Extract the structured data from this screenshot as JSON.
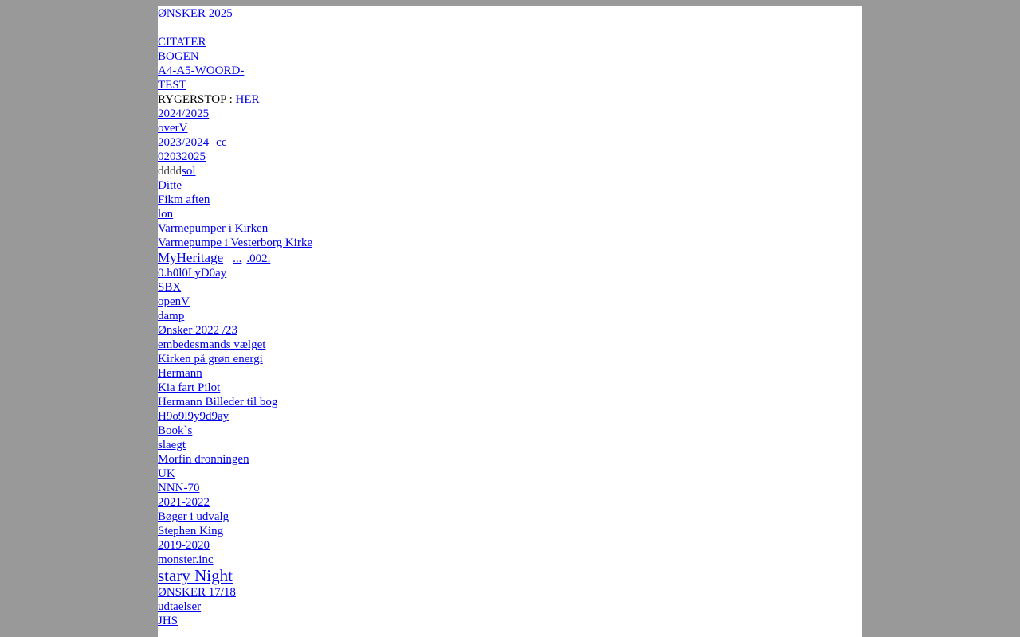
{
  "page": {
    "background": "#999999",
    "content_background": "#ffffff",
    "link_color": "#0000ee"
  },
  "links": {
    "onsker_2025": "ØNSKER 2025",
    "citater": "CITATER",
    "bogen": "BOGEN",
    "a4_a5_line1": "A4-A5-WOORD-",
    "a4_a5_line2": "TEST",
    "rygerstop_label": "RYGERSTOP :",
    "rygerstop_her": "HER",
    "y2024_2025": "2024/2025",
    "overv": "overV",
    "y2023_2024": "2023/2024",
    "cc": "cc",
    "d02032025": "02032025",
    "img_dd_1_alt": "dd",
    "img_dd_2_alt": "dd",
    "sol": "sol",
    "ditte": "Ditte",
    "fikm_aften": "Fikm aften",
    "lon": "lon",
    "varmepumper_kirken": "Varmepumper i Kirken",
    "varmepumpe_vesterborg": "Varmepumpe i Vesterborg Kirke",
    "myheritage": "MyHeritage",
    "dots": "...",
    "code_002": ".002.",
    "h0l0": "0.h0l0LyD0ay",
    "sbx": "SBX",
    "openv": "openV",
    "damp": "damp",
    "onsker_2022_23": "Ønsker 2022 /23",
    "embedesmands": "embedesmands vælget",
    "kirken_gron": "Kirken på grøn energi",
    "hermann": "Hermann",
    "kia_fart": "Kia fart Pilot",
    "hermann_billeder": "Hermann Billeder til bog",
    "h9o9l": "H9o9l9y9d9ay",
    "books": "Book`s",
    "slaegt": "slaegt",
    "morfin": "Morfin dronningen",
    "uk": "UK",
    "nnn70": "NNN-70",
    "y2021_2022": "2021-2022",
    "boger_udvalg": "Bøger i udvalg",
    "stephen_king": "Stephen King",
    "y2019_2020": "2019-2020",
    "monster_inc": "monster.inc",
    "stary_night": "stary Night",
    "onsker_17_18": "ØNSKER 17/18",
    "udtaelser": "udtaelser",
    "jhs": "JHS"
  }
}
